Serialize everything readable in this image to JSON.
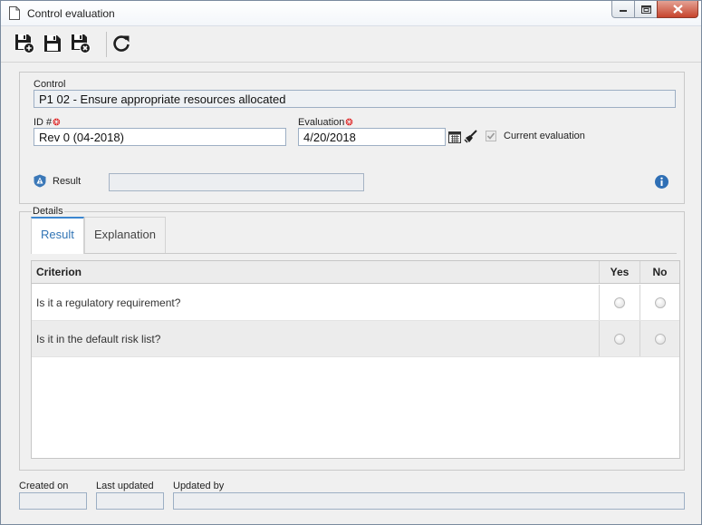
{
  "window": {
    "title": "Control evaluation",
    "icons": {
      "title": "document-icon",
      "minimize": "minimize-icon",
      "maximize": "maximize-icon",
      "close": "close-icon"
    }
  },
  "toolbar": {
    "buttons": [
      {
        "icon": "save-new-icon"
      },
      {
        "icon": "save-icon"
      },
      {
        "icon": "save-close-icon"
      },
      {
        "icon": "refresh-icon"
      }
    ]
  },
  "form": {
    "control_label": "Control",
    "control_value": "P1 02 - Ensure appropriate resources allocated",
    "id_label": "ID #",
    "id_value": "Rev 0 (04-2018)",
    "evaluation_label": "Evaluation",
    "evaluation_value": "4/20/2018",
    "current_evaluation_label": "Current evaluation",
    "current_evaluation_checked": true,
    "result_label": "Result",
    "result_value": "",
    "icons": {
      "required": "required-icon",
      "calendar": "calendar-icon",
      "clear": "broom-icon",
      "result": "shield-warning-icon",
      "info": "info-icon"
    }
  },
  "details": {
    "group_label": "Details",
    "tabs": [
      {
        "label": "Result",
        "active": true
      },
      {
        "label": "Explanation",
        "active": false
      }
    ],
    "table": {
      "columns": [
        "Criterion",
        "Yes",
        "No"
      ],
      "rows": [
        {
          "criterion": "Is it a regulatory requirement?",
          "yes": false,
          "no": false
        },
        {
          "criterion": "Is it in the default risk list?",
          "yes": false,
          "no": false
        }
      ]
    }
  },
  "footer": {
    "created_on_label": "Created on",
    "created_on_value": "",
    "last_updated_label": "Last updated",
    "last_updated_value": "",
    "updated_by_label": "Updated by",
    "updated_by_value": ""
  },
  "colors": {
    "accent": "#3275b5",
    "required": "#dd1111",
    "info": "#2f6fb5"
  }
}
